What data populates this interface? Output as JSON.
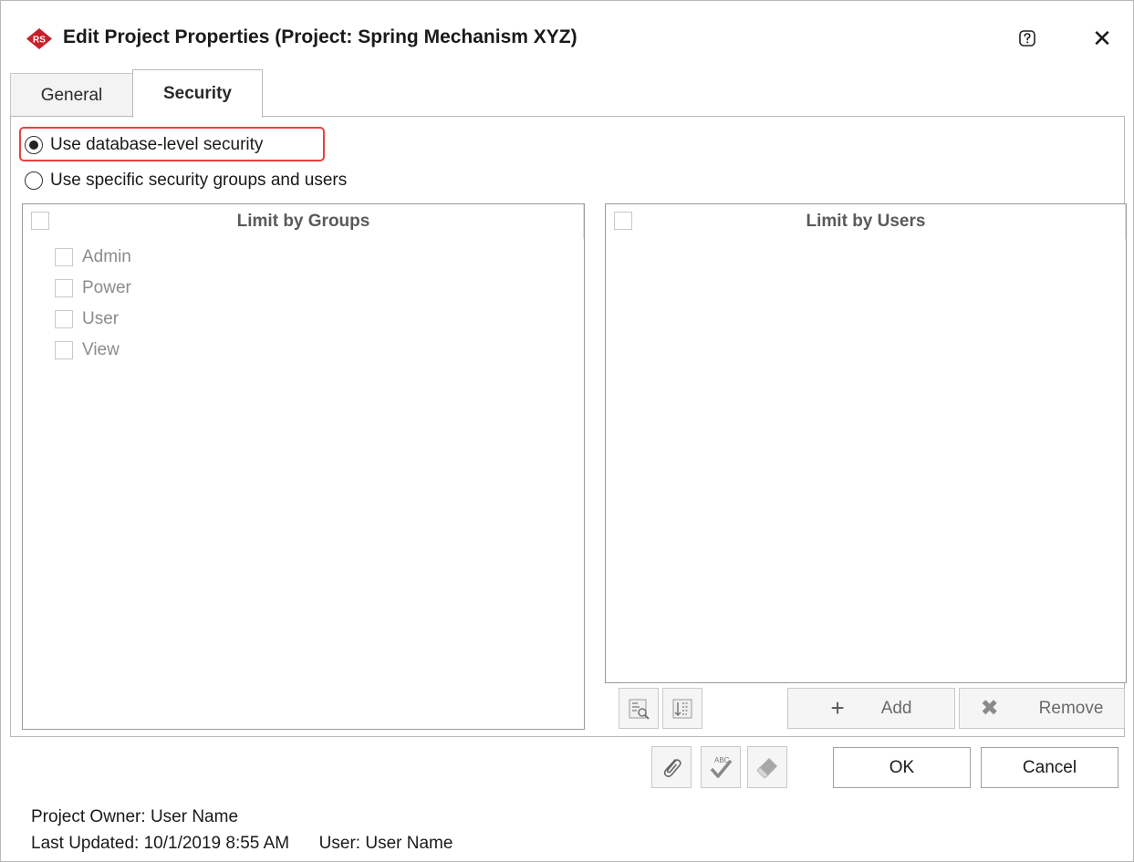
{
  "window": {
    "title": "Edit Project Properties (Project: Spring Mechanism XYZ)",
    "app_icon_text": "RS",
    "help_icon": "help-icon",
    "close_label": "✕"
  },
  "tabs": [
    {
      "label": "General",
      "active": false
    },
    {
      "label": "Security",
      "active": true
    }
  ],
  "security": {
    "option_database": {
      "label": "Use database-level security",
      "selected": true
    },
    "option_specific": {
      "label": "Use specific security groups and users",
      "selected": false
    }
  },
  "groups": {
    "header": "Limit by Groups",
    "items": [
      {
        "label": "Admin",
        "checked": false
      },
      {
        "label": "Power",
        "checked": false
      },
      {
        "label": "User",
        "checked": false
      },
      {
        "label": "View",
        "checked": false
      }
    ]
  },
  "users": {
    "header": "Limit by Users",
    "items": []
  },
  "toolbar": {
    "add_label": "Add",
    "remove_label": "Remove"
  },
  "footer": {
    "ok_label": "OK",
    "cancel_label": "Cancel",
    "owner_label": "Project Owner:",
    "owner_value": "User Name",
    "updated_label": "Last Updated:",
    "updated_value": "10/1/2019 8:55 AM",
    "user_label": "User:",
    "user_value": "User Name"
  },
  "colors": {
    "highlight": "#e8413f",
    "app_icon": "#c8202a"
  }
}
